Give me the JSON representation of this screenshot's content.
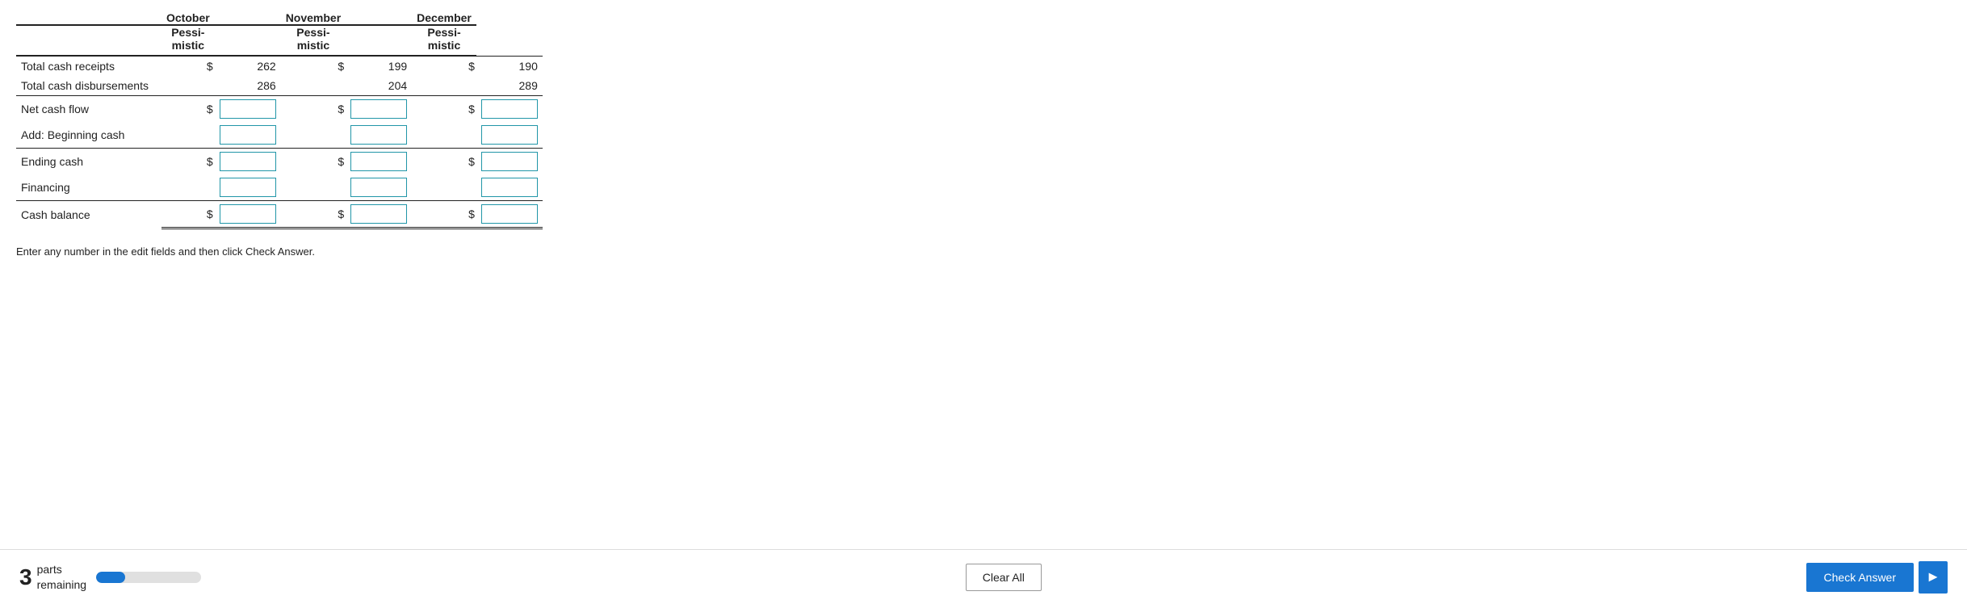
{
  "table": {
    "columns": [
      {
        "id": "october",
        "header": "October",
        "sub": "Pessi-\nmistic"
      },
      {
        "id": "november",
        "header": "November",
        "sub": "Pessi-\nmistic"
      },
      {
        "id": "december",
        "header": "December",
        "sub": "Pessi-\nmistic"
      }
    ],
    "rows": [
      {
        "label": "Total cash receipts",
        "has_dollar": true,
        "values": [
          "262",
          "199",
          "190"
        ],
        "input": false,
        "border_top": true
      },
      {
        "label": "Total cash disbursements",
        "has_dollar": false,
        "values": [
          "286",
          "204",
          "289"
        ],
        "input": false,
        "border_top": false
      },
      {
        "label": "Net cash flow",
        "has_dollar": true,
        "values": [
          "",
          "",
          ""
        ],
        "input": true,
        "border_top": true
      },
      {
        "label": "Add: Beginning cash",
        "has_dollar": false,
        "values": [
          "",
          "",
          ""
        ],
        "input": true,
        "border_top": false
      },
      {
        "label": "Ending cash",
        "has_dollar": true,
        "values": [
          "",
          "",
          ""
        ],
        "input": true,
        "border_top": true
      },
      {
        "label": "Financing",
        "has_dollar": false,
        "values": [
          "",
          "",
          ""
        ],
        "input": true,
        "border_top": false
      },
      {
        "label": "Cash balance",
        "has_dollar": true,
        "values": [
          "",
          "",
          ""
        ],
        "input": true,
        "border_top": true,
        "double_bottom": true
      }
    ]
  },
  "instructions": "Enter any number in the edit fields and then click Check Answer.",
  "footer": {
    "parts_number": "3",
    "parts_remaining": "parts",
    "parts_sub": "remaining",
    "progress_percent": 28,
    "clear_all": "Clear All",
    "check_answer": "Check Answer"
  }
}
